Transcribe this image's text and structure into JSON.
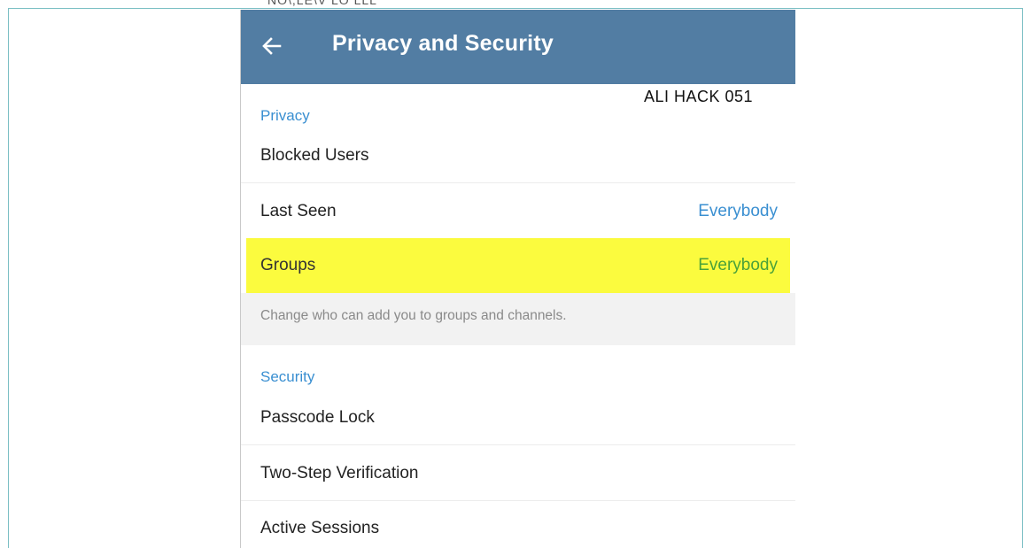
{
  "top_strip_text": "NO\\,LE\\V LO LLL",
  "appbar": {
    "title": "Privacy and Security",
    "back_icon": "arrow-left-icon"
  },
  "watermark": "ALI HACK 051",
  "privacy": {
    "header": "Privacy",
    "items": [
      {
        "label": "Blocked Users",
        "value": ""
      },
      {
        "label": "Last Seen",
        "value": "Everybody"
      },
      {
        "label": "Groups",
        "value": "Everybody"
      }
    ],
    "hint": "Change who can add you to groups and channels."
  },
  "security": {
    "header": "Security",
    "items": [
      {
        "label": "Passcode Lock"
      },
      {
        "label": "Two-Step Verification"
      },
      {
        "label": "Active Sessions"
      }
    ]
  },
  "colors": {
    "appbar": "#527da3",
    "accent": "#3a8fd1",
    "highlight": "#fbfb3e",
    "highlight_value": "#4aa13a",
    "frame": "#7bbfc4"
  }
}
